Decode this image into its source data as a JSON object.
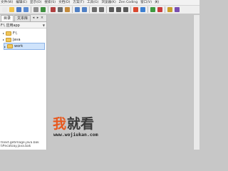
{
  "menu": [
    "文件(W)",
    "编辑(E)",
    "显示(O)",
    "搜索(S)",
    "文档(D)",
    "方案(T)",
    "工具(G)",
    "浏览器(K)",
    "Zen Coding",
    "窗口(V)",
    "关("
  ],
  "toolbar_icons": [
    {
      "name": "new-file-icon",
      "color": "#e9e9e9"
    },
    {
      "name": "open-folder-icon",
      "color": "#f0c24a"
    },
    {
      "name": "save-icon",
      "color": "#4a7ac6"
    },
    {
      "name": "save-all-icon",
      "color": "#5b8ad0"
    },
    {
      "name": "sep"
    },
    {
      "name": "print-icon",
      "color": "#8c8c8c"
    },
    {
      "name": "preview-icon",
      "color": "#3f8f3f"
    },
    {
      "name": "sep"
    },
    {
      "name": "cut-icon",
      "color": "#b04040"
    },
    {
      "name": "copy-icon",
      "color": "#6a6a6a"
    },
    {
      "name": "paste-icon",
      "color": "#c48a3a"
    },
    {
      "name": "sep"
    },
    {
      "name": "undo-icon",
      "color": "#4f7fc4"
    },
    {
      "name": "redo-icon",
      "color": "#4f7fc4"
    },
    {
      "name": "sep"
    },
    {
      "name": "find-icon",
      "color": "#6a6a6a"
    },
    {
      "name": "replace-icon",
      "color": "#6a6a6a"
    },
    {
      "name": "sep"
    },
    {
      "name": "indent-icon",
      "color": "#5a5a5a"
    },
    {
      "name": "outdent-icon",
      "color": "#5a5a5a"
    },
    {
      "name": "wrap-icon",
      "color": "#5a5a5a"
    },
    {
      "name": "sep"
    },
    {
      "name": "browser-icon",
      "color": "#d9482f"
    },
    {
      "name": "ie-icon",
      "color": "#3c7fd1"
    },
    {
      "name": "sep"
    },
    {
      "name": "run-icon",
      "color": "#3f9a3f"
    },
    {
      "name": "stop-icon",
      "color": "#c93c3c"
    },
    {
      "name": "sep"
    },
    {
      "name": "bookmark-icon",
      "color": "#c9a02a"
    },
    {
      "name": "macro-icon",
      "color": "#7a4fb0"
    }
  ],
  "left_panel": {
    "tabs": [
      "目录",
      "文本库"
    ],
    "tab_controls": [
      "◂",
      "▸",
      "×"
    ],
    "folder_selector": "F:\\ 应用app",
    "tree": [
      {
        "label": "F:\\"
      },
      {
        "label": "Java"
      },
      {
        "label": "work",
        "selected": true
      }
    ],
    "bottom_text": [
      "tnext.getimage.java.bak",
      "t#ecatoay.java.bak"
    ]
  },
  "watermark": {
    "brand": "我就看",
    "url": "www.wojiukan.com"
  }
}
